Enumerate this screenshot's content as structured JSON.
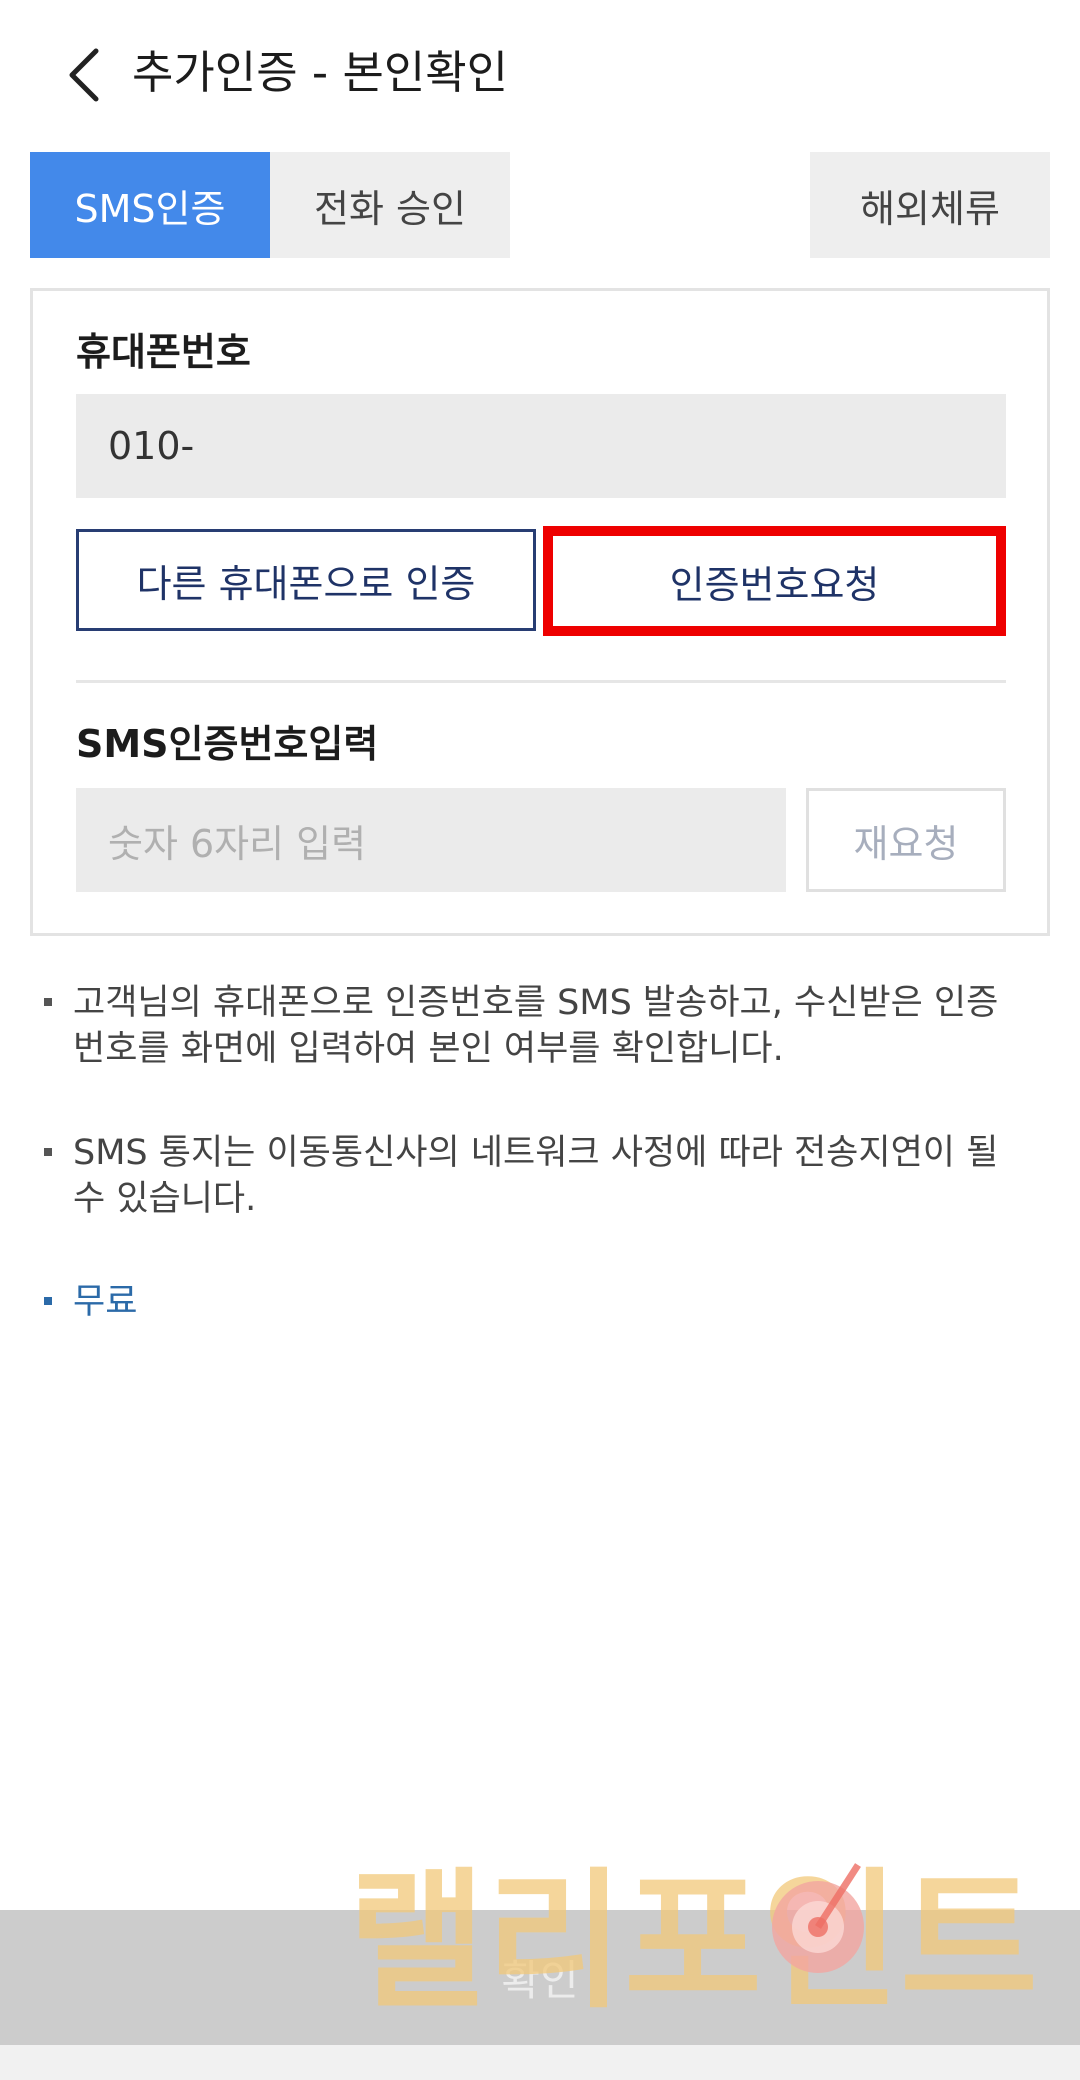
{
  "header": {
    "back_icon": "chevron-left-icon",
    "title": "추가인증 - 본인확인"
  },
  "tabs": [
    {
      "label": "SMS인증",
      "active": true
    },
    {
      "label": "전화 승인",
      "active": false
    },
    {
      "label": "해외체류",
      "active": false
    }
  ],
  "form": {
    "phone_label": "휴대폰번호",
    "phone_value": "010-",
    "other_phone_button": "다른 휴대폰으로 인증",
    "request_code_button": "인증번호요청",
    "sms_label": "SMS인증번호입력",
    "code_placeholder": "숫자 6자리 입력",
    "resend_button": "재요청"
  },
  "notes": [
    "고객님의 휴대폰으로 인증번호를 SMS 발송하고, 수신받은 인증번호를 화면에 입력하여 본인 여부를 확인합니다.",
    "SMS 통지는 이동통신사의 네트워크 사정에 따라 전송지연이 될 수 있습니다.",
    "무료"
  ],
  "confirm_button": "확인",
  "watermark": "랠리포인트",
  "colors": {
    "accent_blue": "#4389ea",
    "navy": "#283d73",
    "highlight_red": "#ee0000",
    "link_blue": "#2b6aa8",
    "watermark": "#f1c879"
  }
}
